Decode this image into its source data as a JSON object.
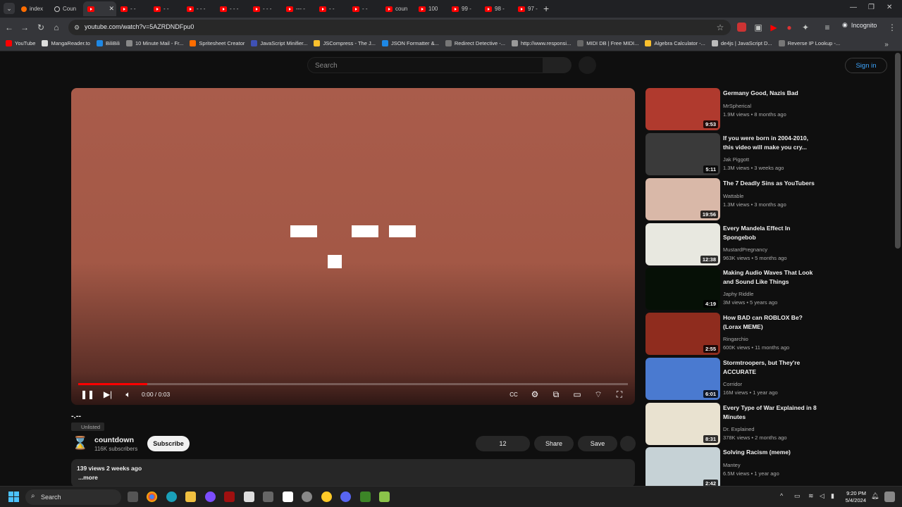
{
  "browser": {
    "tabs": [
      {
        "label": "index",
        "icon": "orange"
      },
      {
        "label": "Coun",
        "icon": "globe"
      },
      {
        "label": "",
        "icon": "yt",
        "active": true
      },
      {
        "label": "- -",
        "icon": "yt"
      },
      {
        "label": "- -",
        "icon": "yt"
      },
      {
        "label": "- - -",
        "icon": "yt"
      },
      {
        "label": "- - -",
        "icon": "yt"
      },
      {
        "label": "- - -",
        "icon": "yt"
      },
      {
        "label": "--- -",
        "icon": "yt"
      },
      {
        "label": "- -",
        "icon": "yt"
      },
      {
        "label": "- -",
        "icon": "yt"
      },
      {
        "label": "coun",
        "icon": "yt"
      },
      {
        "label": "100",
        "icon": "yt"
      },
      {
        "label": "99 -",
        "icon": "yt"
      },
      {
        "label": "98 -",
        "icon": "yt"
      },
      {
        "label": "97 -",
        "icon": "yt"
      }
    ],
    "new_tab": "+",
    "url": "youtube.com/watch?v=5AZRDNDFpu0",
    "incognito_label": "Incognito",
    "bookmarks": [
      "YouTube",
      "MangaReader.to",
      "BiliBili",
      "10 Minute Mail - Fr...",
      "Spritesheet Creator",
      "JavaScript Minifier...",
      "JSCompress - The J...",
      "JSON Formatter &...",
      "Redirect Detective -...",
      "http://www.responsi...",
      "MIDI DB | Free MIDI...",
      "Algebra Calculator -...",
      "de4js | JavaScript D...",
      "Reverse IP Lookup -..."
    ]
  },
  "youtube": {
    "search_placeholder": "Search",
    "sign_in": "Sign in"
  },
  "player": {
    "time": "0:00 / 0:03",
    "progress_fraction": 0.125
  },
  "video": {
    "title": "-.--",
    "unlisted": "Unlisted",
    "channel_name": "countdown",
    "subscribers": "116K subscribers",
    "subscribe_label": "Subscribe",
    "likes": "12",
    "share_label": "Share",
    "save_label": "Save",
    "views_date": "139 views  2 weeks ago",
    "more_label": "...more"
  },
  "recommendations": [
    {
      "title": "Germany Good, Nazis Bad",
      "channel": "MrSpherical",
      "meta": "1.9M views • 8 months ago",
      "duration": "9:53",
      "color": "#b03a2e"
    },
    {
      "title": "If you were born in 2004-2010, this video will make you cry...",
      "channel": "Jak Piggott",
      "meta": "1.3M views • 3 weeks ago",
      "duration": "5:11",
      "color": "#3a3a3a"
    },
    {
      "title": "The 7 Deadly Sins as YouTubers",
      "channel": "Wattable",
      "meta": "1.3M views • 3 months ago",
      "duration": "19:56",
      "color": "#d9b8a8"
    },
    {
      "title": "Every Mandela Effect In Spongebob",
      "channel": "MustardPregnancy",
      "meta": "963K views • 5 months ago",
      "duration": "12:38",
      "color": "#e8e8e0"
    },
    {
      "title": "Making Audio Waves That Look and Sound Like Things",
      "channel": "Japhy Riddle",
      "meta": "3M views • 5 years ago",
      "duration": "4:19",
      "color": "#061006"
    },
    {
      "title": "How BAD can ROBLOX Be? (Lorax MEME)",
      "channel": "Ringarchio",
      "meta": "600K views • 11 months ago",
      "duration": "2:55",
      "color": "#8f2c1e"
    },
    {
      "title": "Stormtroopers, but They're ACCURATE",
      "channel": "Corridor",
      "meta": "16M views • 1 year ago",
      "duration": "6:01",
      "color": "#4a7ad0"
    },
    {
      "title": "Every Type of War Explained in 8 Minutes",
      "channel": "Dr. Explained",
      "meta": "378K views • 2 months ago",
      "duration": "8:31",
      "color": "#e9e2d0"
    },
    {
      "title": "Solving Racism (meme)",
      "channel": "Mantey",
      "meta": "6.5M views • 1 year ago",
      "duration": "2:42",
      "color": "#c6d2d6"
    }
  ],
  "taskbar": {
    "search_label": "Search",
    "time": "9:20 PM",
    "date": "5/4/2024"
  }
}
